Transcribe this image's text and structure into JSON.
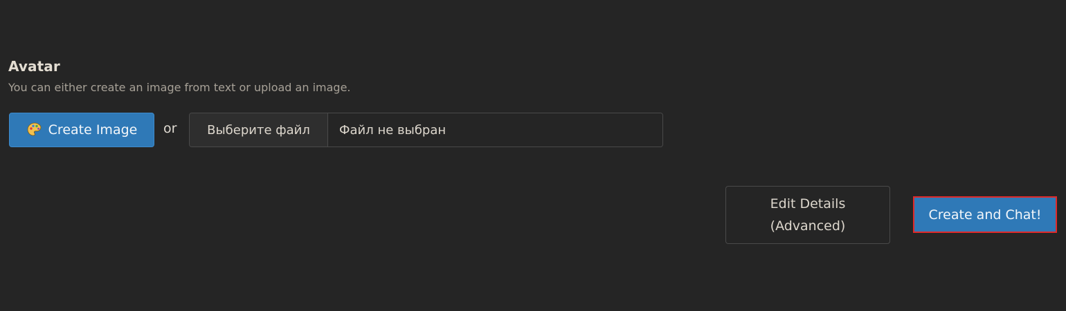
{
  "avatar": {
    "title": "Avatar",
    "hint": "You can either create an image from text or upload an image."
  },
  "create_image": {
    "icon": "palette-icon",
    "label": "Create Image"
  },
  "or_text": "or",
  "file_input": {
    "button_label": "Выберите файл",
    "status": "Файл не выбран"
  },
  "edit_details": {
    "line1": "Edit Details",
    "line2": "(Advanced)"
  },
  "create_chat": {
    "label": "Create and Chat!"
  },
  "colors": {
    "background": "#252525",
    "primary_button": "#2f79b7",
    "highlight_border": "#e02a2a"
  }
}
